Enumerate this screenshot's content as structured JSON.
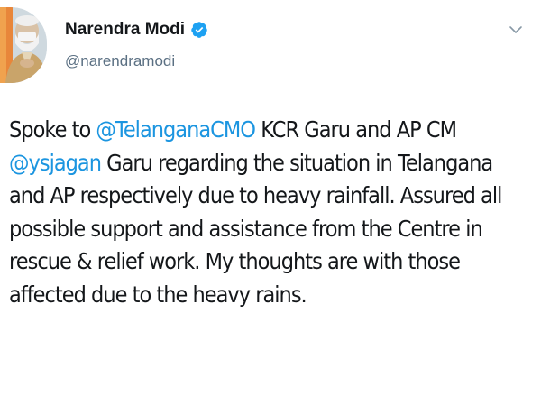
{
  "tweet": {
    "author": {
      "display_name": "Narendra Modi",
      "handle": "@narendramodi",
      "verified": true,
      "avatar_icon": "profile-photo"
    },
    "menu_icon": "chevron-down-icon",
    "text_lines": [
      [
        {
          "text": "Spoke to ",
          "mention": false
        },
        {
          "text": "@TelanganaCMO",
          "mention": true
        },
        {
          "text": " KCR Garu and AP CM",
          "mention": false
        }
      ],
      [
        {
          "text": "@ysjagan",
          "mention": true
        },
        {
          "text": " Garu regarding the situation in Telangana",
          "mention": false
        }
      ],
      [
        {
          "text": "and AP respectively due to heavy rainfall. Assured all",
          "mention": false
        }
      ],
      [
        {
          "text": "possible support and assistance from the Centre in",
          "mention": false
        }
      ],
      [
        {
          "text": "rescue & relief work. My thoughts are with those",
          "mention": false
        }
      ],
      [
        {
          "text": "affected due to the heavy rains.",
          "mention": false
        }
      ]
    ]
  },
  "colors": {
    "mention": "#1b95e0",
    "text": "#14171a",
    "secondary": "#5b7083",
    "verified_badge": "#1da1f2"
  }
}
